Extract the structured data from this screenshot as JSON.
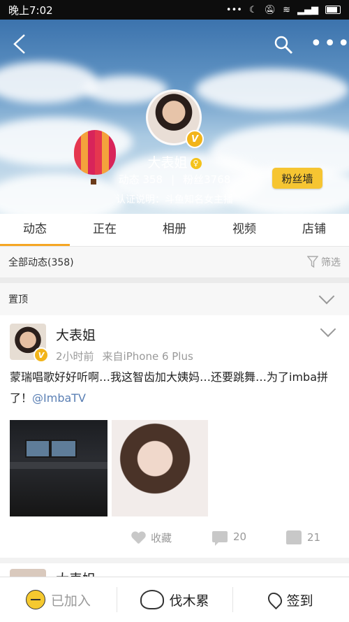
{
  "status_bar": {
    "time": "晚上7:02",
    "icons": [
      "more-dots-icon",
      "moon-icon",
      "mute-bell-icon",
      "wifi-icon",
      "signal-icon",
      "battery-icon"
    ]
  },
  "header": {
    "profile_name": "大表姐",
    "verified_badge": "V",
    "gender_symbol": "♀",
    "stats_posts_label": "动态 358",
    "stats_divider": "|",
    "stats_fans_label": "粉丝3768",
    "certification": "认证说明：斗鱼知名女主播",
    "fans_wall_button": "粉丝墙",
    "more_glyph": "•••"
  },
  "tabs": [
    {
      "label": "动态",
      "active": true
    },
    {
      "label": "正在",
      "active": false
    },
    {
      "label": "相册",
      "active": false
    },
    {
      "label": "视频",
      "active": false
    },
    {
      "label": "店铺",
      "active": false
    }
  ],
  "filter": {
    "all_posts": "全部动态(358)",
    "filter_label": "筛选"
  },
  "pinned": {
    "label": "置顶"
  },
  "post": {
    "author": "大表姐",
    "time_ago": "2小时前",
    "source": "来自iPhone 6 Plus",
    "text_main": "蒙瑞唱歌好好听啊…我这智齿加大姨妈…还要跳舞…为了imba拼了！",
    "mention": "@ImbaTV",
    "actions": {
      "favorite": "收藏",
      "comments": "20",
      "likes": "21"
    }
  },
  "next_post": {
    "author": "大表姐"
  },
  "bottom_bar": {
    "joined": "已加入",
    "community": "伐木累",
    "checkin": "签到"
  },
  "colors": {
    "accent": "#f5a623",
    "link": "#5a7fb4",
    "fans_wall_bg": "#f6c532"
  }
}
